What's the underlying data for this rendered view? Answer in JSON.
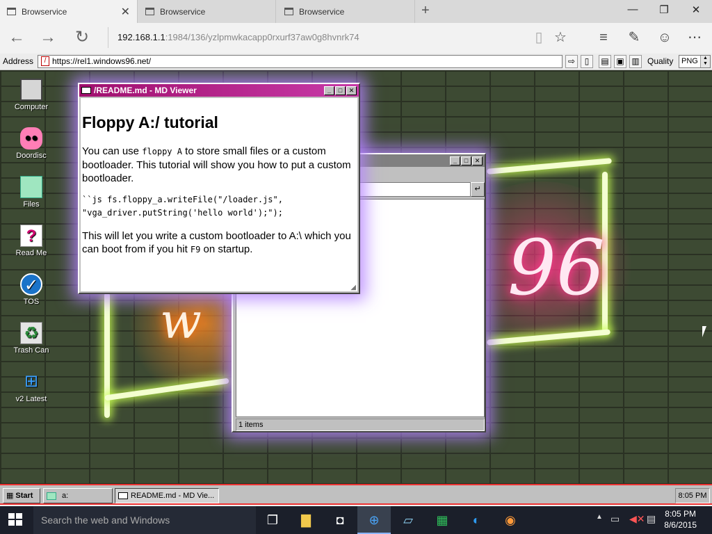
{
  "browser": {
    "tabs": [
      {
        "title": "Browservice",
        "active": true
      },
      {
        "title": "Browservice",
        "active": false
      },
      {
        "title": "Browservice",
        "active": false
      }
    ],
    "url_host": "192.168.1.1",
    "url_rest": ":1984/136/yzlpmwkacapp0rxurf37aw0g8hvnrk74"
  },
  "emubar": {
    "address_label": "Address",
    "address_value": "https://rel1.windows96.net/",
    "quality_label": "Quality",
    "quality_value": "PNG"
  },
  "desktop_icons": [
    {
      "label": "Computer",
      "icon": "computer-icon"
    },
    {
      "label": "Doordisc",
      "icon": "discord-icon"
    },
    {
      "label": "Files",
      "icon": "folder-icon"
    },
    {
      "label": "Read Me",
      "icon": "readme-icon"
    },
    {
      "label": "TOS",
      "icon": "tos-icon"
    },
    {
      "label": "Trash Can",
      "icon": "trash-icon"
    },
    {
      "label": "v2 Latest",
      "icon": "windows-icon"
    }
  ],
  "md_viewer": {
    "title": "/README.md - MD Viewer",
    "heading": "Floppy A:/ tutorial",
    "p1_a": "You can use ",
    "p1_code": "floppy A",
    "p1_b": " to store small files or a custom bootloader. This tutorial will show you how to put a custom bootloader.",
    "code_line1": "``js fs.floppy_a.writeFile(\"/loader.js\",",
    "code_line2": "\"vga_driver.putString('hello world');\");",
    "p2_a": "This will let you write a custom bootloader to A:\\ which you can boot from if you hit ",
    "p2_code": "F9",
    "p2_b": " on startup."
  },
  "explorer": {
    "status": "1 items"
  },
  "w96_taskbar": {
    "start_label": "Start",
    "task1": "a:",
    "task2": "README.md - MD Vie...",
    "clock": "8:05 PM"
  },
  "windows_taskbar": {
    "search_placeholder": "Search the web and Windows",
    "time": "8:05 PM",
    "date": "8/6/2015"
  }
}
